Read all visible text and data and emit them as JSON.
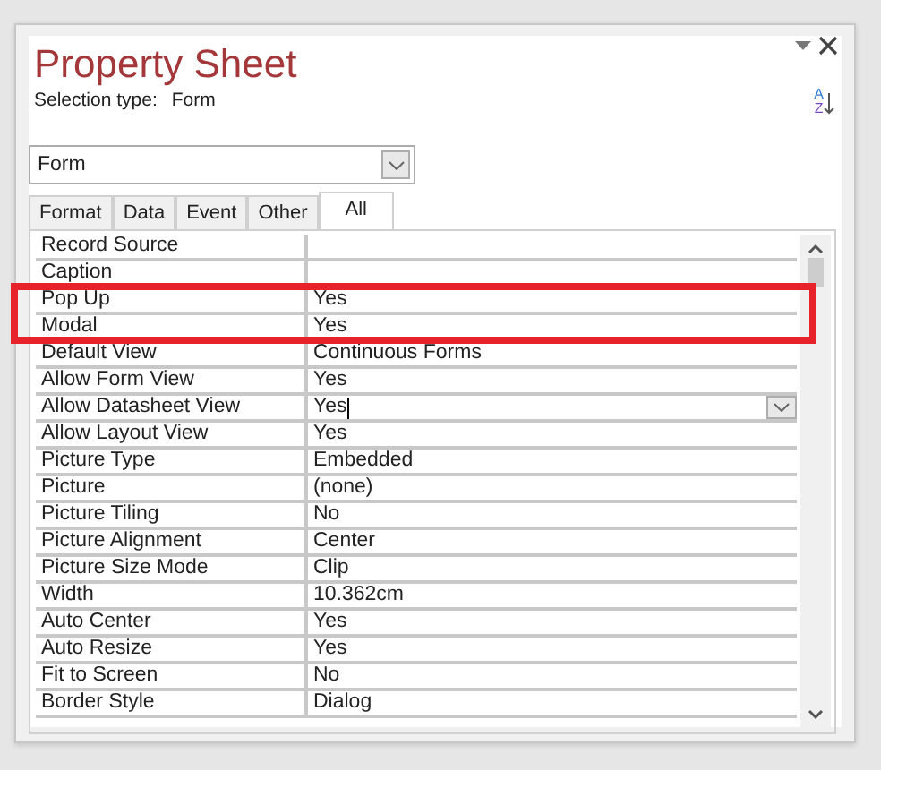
{
  "panel": {
    "title": "Property Sheet",
    "selection_type_label": "Selection type:",
    "selection_type_value": "Form"
  },
  "sort_button": {
    "letter_top": "A",
    "letter_bottom": "Z"
  },
  "object_combo": {
    "value": "Form"
  },
  "tabs": [
    {
      "label": "Format",
      "selected": false
    },
    {
      "label": "Data",
      "selected": false
    },
    {
      "label": "Event",
      "selected": false
    },
    {
      "label": "Other",
      "selected": false
    },
    {
      "label": "All",
      "selected": true
    }
  ],
  "property_groups": [
    {
      "highlighted": false,
      "properties": [
        {
          "name": "Record Source",
          "focused": false
        },
        {
          "name": "Caption",
          "focused": false
        }
      ]
    },
    {
      "highlighted": true,
      "properties": [
        {
          "name": "Pop Up",
          "value": "Yes",
          "focused": false
        },
        {
          "name": "Modal",
          "value": "Yes",
          "focused": false
        }
      ]
    },
    {
      "highlighted": false,
      "properties": [
        {
          "name": "Default View",
          "value": "Continuous Forms",
          "focused": false
        },
        {
          "name": "Allow Form View",
          "value": "Yes",
          "focused": false
        },
        {
          "name": "Allow Datasheet View",
          "value": "Yes",
          "focused": true
        },
        {
          "name": "Allow Layout View",
          "value": "Yes",
          "focused": false
        },
        {
          "name": "Picture Type",
          "value": "Embedded",
          "focused": false
        },
        {
          "name": "Picture",
          "value": "(none)",
          "focused": false
        },
        {
          "name": "Picture Tiling",
          "value": "No",
          "focused": false
        },
        {
          "name": "Picture Alignment",
          "value": "Center",
          "focused": false
        },
        {
          "name": "Picture Size Mode",
          "value": "Clip",
          "focused": false
        },
        {
          "name": "Width",
          "value": "10.362cm",
          "focused": false
        },
        {
          "name": "Auto Center",
          "value": "Yes",
          "focused": false
        },
        {
          "name": "Auto Resize",
          "value": "Yes",
          "focused": false
        },
        {
          "name": "Fit to Screen",
          "value": "No",
          "focused": false
        },
        {
          "name": "Border Style",
          "value": "Dialog",
          "focused": false
        }
      ]
    }
  ]
}
